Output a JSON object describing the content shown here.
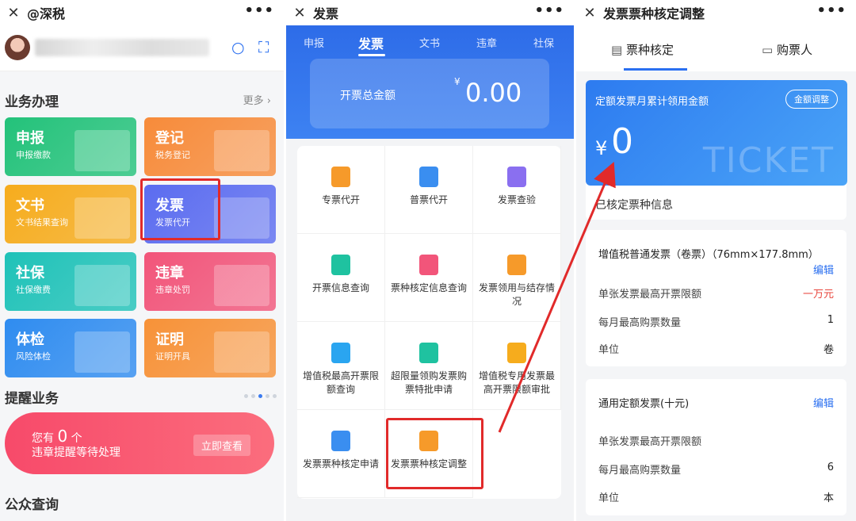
{
  "panel1": {
    "title": "@深税",
    "section_business": "业务办理",
    "more": "更多",
    "tiles": [
      {
        "title": "申报",
        "sub": "申报缴款",
        "color": "#23c27a"
      },
      {
        "title": "登记",
        "sub": "税务登记",
        "color": "#f78b3a"
      },
      {
        "title": "文书",
        "sub": "文书结果查询",
        "color": "#f6ac1d"
      },
      {
        "title": "发票",
        "sub": "发票代开",
        "color": "#5b6cf0"
      },
      {
        "title": "社保",
        "sub": "社保缴费",
        "color": "#1fc2b8"
      },
      {
        "title": "违章",
        "sub": "违章处罚",
        "color": "#f2557a"
      },
      {
        "title": "体检",
        "sub": "风险体检",
        "color": "#2f8cf0"
      },
      {
        "title": "证明",
        "sub": "证明开具",
        "color": "#f79238"
      }
    ],
    "section_reminder": "提醒业务",
    "alert_prefix": "您有",
    "alert_count": "0",
    "alert_suffix": "个",
    "alert_line2": "违章提醒等待处理",
    "alert_button": "立即查看",
    "section_public": "公众查询"
  },
  "panel2": {
    "title": "发票",
    "tabs": [
      "申报",
      "发票",
      "文书",
      "违章",
      "社保"
    ],
    "amount_label": "开票总金额",
    "currency": "¥",
    "amount": "0.00",
    "items": [
      "专票代开",
      "普票代开",
      "发票查验",
      "开票信息查询",
      "票种核定信息查询",
      "发票领用与结存情况",
      "增值税最高开票限额查询",
      "超限量领购发票购票特批申请",
      "增值税专用发票最高开票限额审批",
      "发票票种核定申请",
      "发票票种核定调整"
    ]
  },
  "panel3": {
    "title": "发票票种核定调整",
    "tab1": "票种核定",
    "tab2": "购票人",
    "card_title": "定额发票月累计领用金额",
    "adjust_button": "金额调整",
    "yen": "¥",
    "value": "0",
    "watermark": "TICKET",
    "info_label": "已核定票种信息",
    "invoice1": {
      "name": "增值税普通发票（卷票）（76mm×177.8mm）",
      "edit": "编辑",
      "rows": [
        [
          "单张发票最高开票限额",
          "一万元"
        ],
        [
          "每月最高购票数量",
          "1"
        ],
        [
          "单位",
          "卷"
        ]
      ]
    },
    "invoice2": {
      "name": "通用定额发票(十元)",
      "edit": "编辑",
      "rows": [
        [
          "单张发票最高开票限额",
          ""
        ],
        [
          "每月最高购票数量",
          "6"
        ],
        [
          "单位",
          "本"
        ]
      ]
    }
  }
}
